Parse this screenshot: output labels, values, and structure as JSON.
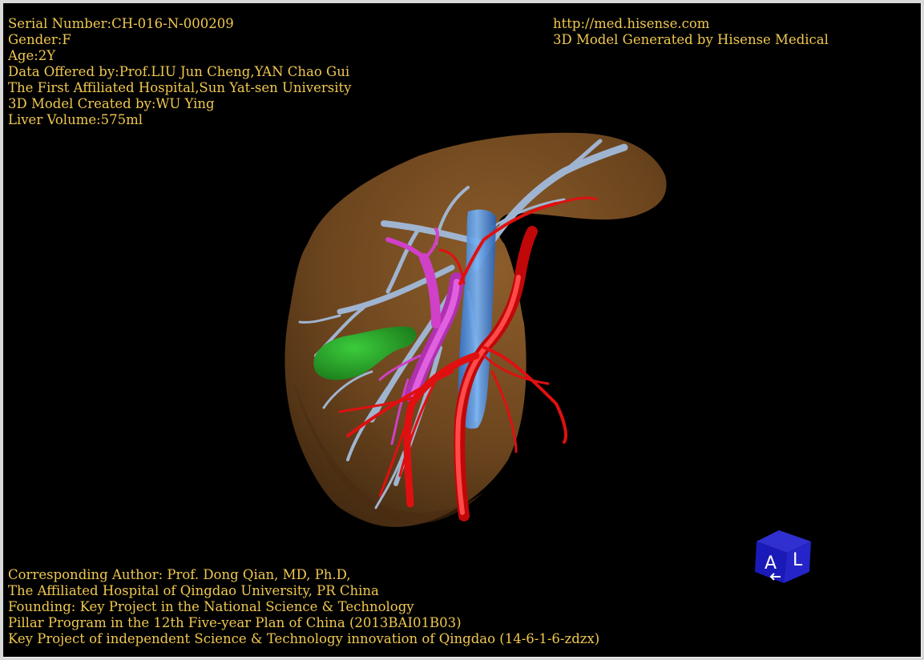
{
  "header_left": {
    "serial": "Serial Number:CH-016-N-000209",
    "gender": "Gender:F",
    "age": "Age:2Y",
    "data_offered": "Data Offered by:Prof.LIU Jun Cheng,YAN Chao Gui",
    "hospital": "The First Affiliated Hospital,Sun Yat-sen University",
    "model_creator": "3D Model Created by:WU Ying",
    "liver_volume": "Liver Volume:575ml"
  },
  "header_right": {
    "url": "http://med.hisense.com",
    "generator": "3D Model Generated by Hisense Medical"
  },
  "footer": {
    "author": "Corresponding Author: Prof. Dong Qian, MD, Ph.D,",
    "affiliation": "The Affiliated Hospital of Qingdao University, PR China",
    "founding": "Founding: Key Project in the National Science & Technology",
    "pillar": "Pillar Program in the 12th Five-year Plan of China (2013BAI01B03)",
    "qingdao_project": "Key Project of independent Science & Technology innovation of Qingdao (14-6-1-6-zdzx)"
  },
  "orientation_cube": {
    "face_front": "A",
    "face_side": "L"
  },
  "colors": {
    "text": "#f0c850",
    "background": "#000000",
    "liver": "#8a5a2a",
    "hepatic_vein": "#9fb4d0",
    "portal_vein": "#d040c8",
    "artery": "#e01010",
    "ivc": "#4a90e0",
    "gallbladder": "#2aa82a",
    "cube": "#1a1ab8"
  }
}
